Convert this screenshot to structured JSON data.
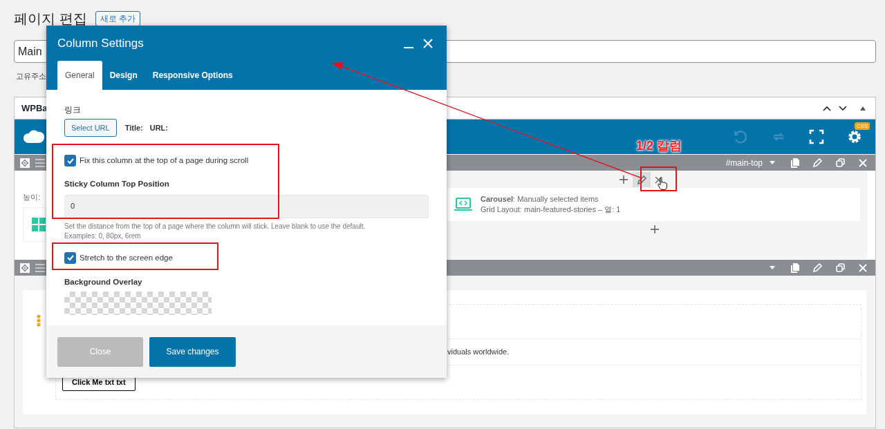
{
  "page": {
    "heading": "페이지 편집",
    "add_new_button": "새로 추가",
    "title_value": "Main",
    "permalink_label": "고유주소"
  },
  "builder": {
    "title": "WPBa",
    "toolbar": [
      {
        "kind": "undo",
        "disabled": true
      },
      {
        "kind": "redo",
        "disabled": true
      },
      {
        "kind": "fullscreen",
        "disabled": false
      },
      {
        "kind": "settings",
        "disabled": false,
        "badge": "CSS"
      }
    ],
    "row_1": {
      "tag": "#main-top",
      "height_label": "높이:",
      "element_title": "**Carousel**: Manually selected items",
      "element_subtitle": "Grid Layout: main-featured-stories – 열: 1"
    },
    "row_2": {
      "text_fragment": "viduals worldwide.",
      "button": "Click Me txt txt"
    }
  },
  "modal": {
    "title": "Column Settings",
    "tabs": [
      {
        "label": "General",
        "selected": true
      },
      {
        "label": "Design",
        "selected": false
      },
      {
        "label": "Responsive Options",
        "selected": false
      }
    ],
    "link_label": "링크",
    "select_url_button": "Select URL",
    "title_label": "Title:",
    "url_label": "URL:",
    "sticky_checkbox": {
      "label": "Fix this column at the top of a page during scroll",
      "checked": true
    },
    "sticky_position": {
      "label": "Sticky Column Top Position",
      "value": "0",
      "help": "Set the distance from the top of a page where the column will stick. Leave blank to use the default.",
      "examples": "Examples: 0, 80px, 6rem"
    },
    "stretch_checkbox": {
      "label": "Stretch to the screen edge",
      "checked": true
    },
    "background_overlay_label": "Background Overlay",
    "close_button": "Close",
    "save_button": "Save changes"
  },
  "annotation": {
    "label": "1/2 칼럼"
  }
}
